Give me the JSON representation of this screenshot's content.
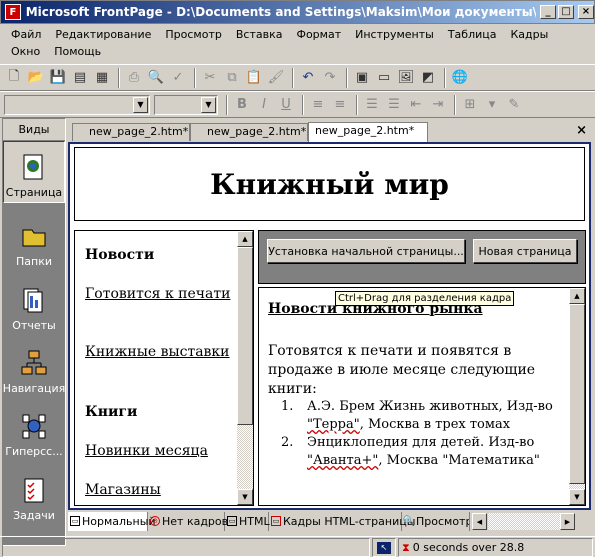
{
  "window": {
    "title": "Microsoft FrontPage - D:\\Documents and Settings\\Maksim\\Мои документы\\Mou Web\\n...",
    "min": "_",
    "max": "□",
    "close": "×"
  },
  "menu": [
    "Файл",
    "Редактирование",
    "Просмотр",
    "Вставка",
    "Формат",
    "Инструменты",
    "Таблица",
    "Кадры",
    "Окно",
    "Помощь"
  ],
  "views": {
    "header": "Виды",
    "items": [
      {
        "label": "Страница",
        "icon": "page-view-icon",
        "selected": true
      },
      {
        "label": "Папки",
        "icon": "folder-icon"
      },
      {
        "label": "Отчеты",
        "icon": "reports-icon"
      },
      {
        "label": "Навигация",
        "icon": "navigation-icon"
      },
      {
        "label": "Гиперсс...",
        "icon": "hyperlinks-icon"
      },
      {
        "label": "Задачи",
        "icon": "tasks-icon"
      }
    ]
  },
  "tabs": [
    "new_page_2.htm*",
    "new_page_2.htm*",
    "new_page_2.htm*"
  ],
  "tab_close": "×",
  "page": {
    "banner": "Книжный мир",
    "left_links": [
      "Новости",
      "Готовится к печати",
      "Книжные выставки",
      "Книги",
      "Новинки месяца",
      "Магазины"
    ],
    "buttons": [
      "Установка начальной страницы...",
      "Новая страница"
    ],
    "tooltip": "Ctrl+Drag для разделения кадра",
    "main": {
      "heading": "Новости книжного рынка",
      "intro": "Готовятся к печати и появятся в продаже в июле месяце следующие книги:",
      "list": [
        {
          "n": "1.",
          "a": "А.Э. Брем Жизнь животных, Изд-во ",
          "b": "\"Терра\"",
          "c": ", Москва в трех томах"
        },
        {
          "n": "2.",
          "a": "Энциклопедия для детей. Изд-во ",
          "b": "\"Аванта+\"",
          "c": ", Москва \"Математика\""
        }
      ]
    }
  },
  "view_tabs": [
    "Нормальный",
    "Нет кадров",
    "HTML",
    "Кадры HTML-страницы",
    "Просмотр"
  ],
  "status": {
    "timing": "0 seconds over 28.8"
  }
}
